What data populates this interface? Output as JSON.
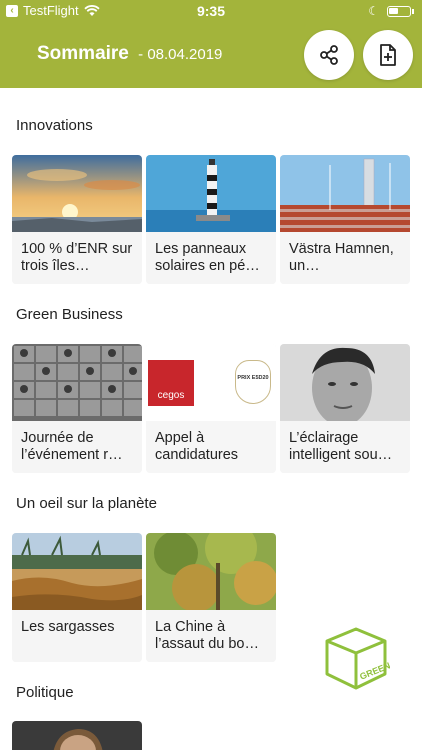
{
  "status_bar": {
    "back_app": "TestFlight",
    "time": "9:35"
  },
  "header": {
    "title": "Sommaire",
    "separator": "-",
    "date": "08.04.2019",
    "bg_color": "#a3b43b"
  },
  "actions": {
    "share_icon": "share-icon",
    "new_document_icon": "file-plus-icon"
  },
  "sections": [
    {
      "title": "Innovations",
      "cards": [
        {
          "label": "100 % d’ENR sur trois îles…"
        },
        {
          "label": "Les panneaux solaires en pé…"
        },
        {
          "label": "Västra Hamnen, un…"
        }
      ]
    },
    {
      "title": "Green Business",
      "cards": [
        {
          "label": "Journée de l’événement r…"
        },
        {
          "label": "Appel à candidatures",
          "logo_text": "cegos",
          "badge_text": "PRIX E5D20"
        },
        {
          "label": "L’éclairage intelligent sou…"
        }
      ]
    },
    {
      "title": "Un oeil sur la planète",
      "cards": [
        {
          "label": "Les sargasses"
        },
        {
          "label": "La Chine à l’assaut du bo…"
        }
      ]
    },
    {
      "title": "Politique",
      "cards": []
    }
  ],
  "floating_logo": {
    "text": "GREEN",
    "color": "#8fc03c"
  }
}
